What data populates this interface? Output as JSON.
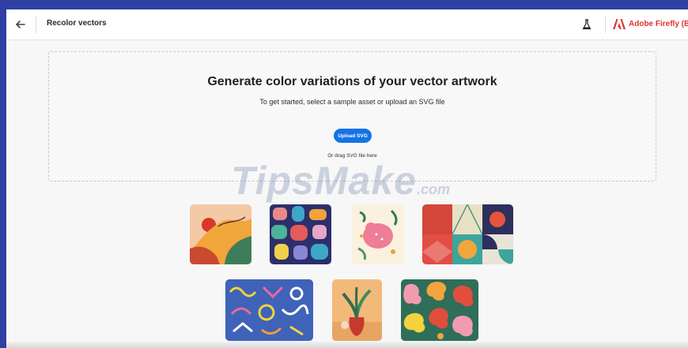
{
  "header": {
    "back_icon": "arrow-left-icon",
    "title": "Recolor vectors",
    "labs_icon": "flask-icon",
    "brand_logo": "adobe-logo-icon",
    "brand_name": "Adobe Firefly (Beta)",
    "brand_color": "#e0332d"
  },
  "dropzone": {
    "heading": "Generate color variations of your vector artwork",
    "subheading": "To get started, select a sample asset or upload an SVG file",
    "upload_label": "Upload SVG",
    "drag_hint": "Or drag SVG file here",
    "accent": "#1473e6"
  },
  "watermark": {
    "main": "TipsMake",
    "suffix": ".com"
  },
  "samples": [
    "landscape-abstract",
    "colorful-shapes-pattern",
    "pink-cat-leaves",
    "geometric-tiles",
    "squiggles-pattern",
    "plant-vase",
    "blob-pattern"
  ]
}
